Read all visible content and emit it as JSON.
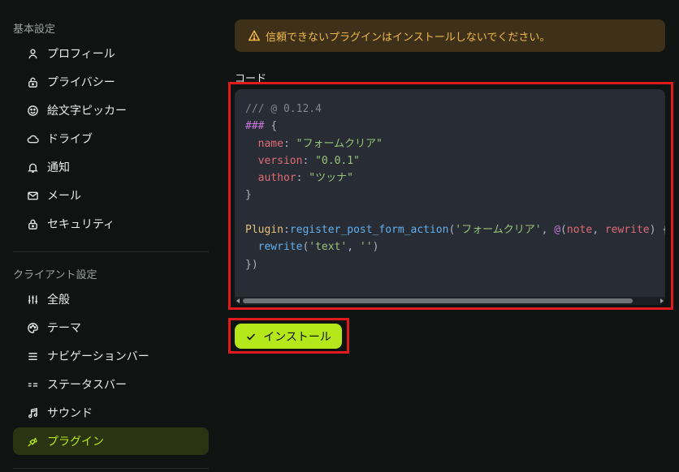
{
  "sidebar": {
    "basic_section": "基本設定",
    "client_section": "クライアント設定",
    "basic_items": [
      {
        "label": "プロフィール",
        "icon": "user-icon"
      },
      {
        "label": "プライバシー",
        "icon": "lock-open-icon"
      },
      {
        "label": "絵文字ピッカー",
        "icon": "emoji-icon"
      },
      {
        "label": "ドライブ",
        "icon": "cloud-icon"
      },
      {
        "label": "通知",
        "icon": "bell-icon"
      },
      {
        "label": "メール",
        "icon": "mail-icon"
      },
      {
        "label": "セキュリティ",
        "icon": "lock-icon"
      }
    ],
    "client_items": [
      {
        "label": "全般",
        "icon": "adjustments-icon"
      },
      {
        "label": "テーマ",
        "icon": "palette-icon"
      },
      {
        "label": "ナビゲーションバー",
        "icon": "menu-icon"
      },
      {
        "label": "ステータスバー",
        "icon": "status-bar-icon"
      },
      {
        "label": "サウンド",
        "icon": "music-icon"
      },
      {
        "label": "プラグイン",
        "icon": "plug-icon",
        "active": true
      }
    ]
  },
  "main": {
    "warning_text": "信頼できないプラグインはインストールしないでください。",
    "code_label": "コード",
    "code_lines": [
      [
        {
          "t": "/// @ 0.12.4",
          "c": "cm"
        }
      ],
      [
        {
          "t": "### ",
          "c": "kw"
        },
        {
          "t": "{",
          "c": "p"
        }
      ],
      [
        {
          "t": "  ",
          "c": "p"
        },
        {
          "t": "name",
          "c": "prop"
        },
        {
          "t": ": ",
          "c": "p"
        },
        {
          "t": "\"フォームクリア\"",
          "c": "str"
        }
      ],
      [
        {
          "t": "  ",
          "c": "p"
        },
        {
          "t": "version",
          "c": "prop"
        },
        {
          "t": ": ",
          "c": "p"
        },
        {
          "t": "\"0.0.1\"",
          "c": "str"
        }
      ],
      [
        {
          "t": "  ",
          "c": "p"
        },
        {
          "t": "author",
          "c": "prop"
        },
        {
          "t": ": ",
          "c": "p"
        },
        {
          "t": "\"ツッナ\"",
          "c": "str"
        }
      ],
      [
        {
          "t": "}",
          "c": "p"
        }
      ],
      [],
      [
        {
          "t": "Plugin",
          "c": "obj"
        },
        {
          "t": ":",
          "c": "p"
        },
        {
          "t": "register_post_form_action",
          "c": "fn"
        },
        {
          "t": "(",
          "c": "p"
        },
        {
          "t": "'フォームクリア'",
          "c": "str"
        },
        {
          "t": ", ",
          "c": "p"
        },
        {
          "t": "@",
          "c": "kw"
        },
        {
          "t": "(",
          "c": "p"
        },
        {
          "t": "note",
          "c": "prop"
        },
        {
          "t": ", ",
          "c": "p"
        },
        {
          "t": "rewrite",
          "c": "prop"
        },
        {
          "t": ") {",
          "c": "p"
        }
      ],
      [
        {
          "t": "  ",
          "c": "p"
        },
        {
          "t": "rewrite",
          "c": "fn"
        },
        {
          "t": "(",
          "c": "p"
        },
        {
          "t": "'text'",
          "c": "str"
        },
        {
          "t": ", ",
          "c": "p"
        },
        {
          "t": "''",
          "c": "str"
        },
        {
          "t": ")",
          "c": "p"
        }
      ],
      [
        {
          "t": "})",
          "c": "p"
        }
      ]
    ],
    "install_label": "インストール"
  },
  "colors": {
    "accent": "#b5e81a",
    "warning_bg": "#3f3019",
    "warning_fg": "#f0b94a",
    "highlight_outline": "#e11b1b"
  }
}
